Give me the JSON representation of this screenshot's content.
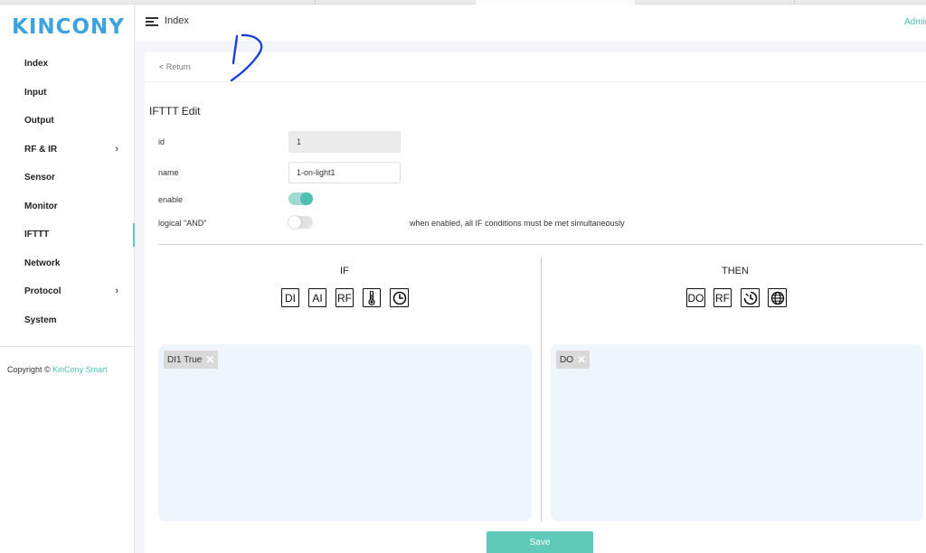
{
  "brand": {
    "logo_text": "KINCONY",
    "logo_color": "#3ea3dd"
  },
  "accent_color": "#4dbfb0",
  "header": {
    "title": "Index",
    "user": "Admin"
  },
  "sidebar": {
    "items": [
      {
        "label": "Index",
        "has_submenu": false
      },
      {
        "label": "Input",
        "has_submenu": false
      },
      {
        "label": "Output",
        "has_submenu": false
      },
      {
        "label": "RF & IR",
        "has_submenu": true
      },
      {
        "label": "Sensor",
        "has_submenu": false
      },
      {
        "label": "Monitor",
        "has_submenu": false
      },
      {
        "label": "IFTTT",
        "has_submenu": false,
        "active": true
      },
      {
        "label": "Network",
        "has_submenu": false
      },
      {
        "label": "Protocol",
        "has_submenu": true
      },
      {
        "label": "System",
        "has_submenu": false
      }
    ],
    "chevron": "›",
    "copyright_prefix": "Copyright © ",
    "copyright_link": "KinCony Smart"
  },
  "page": {
    "return_label": "< Return",
    "title": "IFTTT Edit",
    "form": {
      "id_label": "id",
      "id_value": "1",
      "name_label": "name",
      "name_value": "1-on-light1",
      "enable_label": "enable",
      "enable_state": true,
      "logical_and_label": "logical \"AND\"",
      "logical_and_state": false,
      "logical_and_hint": "when enabled, all IF conditions must be met simultaneously"
    },
    "if_section": {
      "title": "IF",
      "icons": [
        {
          "label": "DI",
          "icon": "di-icon"
        },
        {
          "label": "AI",
          "icon": "ai-icon"
        },
        {
          "label": "RF",
          "icon": "rf-icon"
        },
        {
          "label": "",
          "icon": "thermometer-icon"
        },
        {
          "label": "",
          "icon": "clock-icon"
        }
      ],
      "chips": [
        {
          "label": "DI1 True",
          "remove": "✕"
        }
      ]
    },
    "then_section": {
      "title": "THEN",
      "icons": [
        {
          "label": "DO",
          "icon": "do-icon"
        },
        {
          "label": "RF",
          "icon": "rf-icon"
        },
        {
          "label": "",
          "icon": "timer-icon"
        },
        {
          "label": "",
          "icon": "globe-icon"
        }
      ],
      "chips": [
        {
          "label": "DO",
          "remove": "✕"
        }
      ]
    },
    "save_label": "Save"
  }
}
